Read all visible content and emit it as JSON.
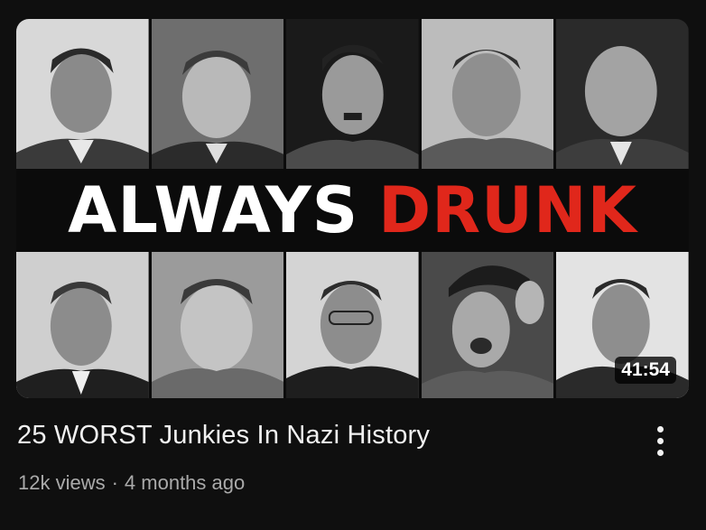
{
  "video": {
    "thumbnail_text_1": "ALWAYS",
    "thumbnail_text_2": "DRUNK",
    "duration": "41:54",
    "title": "25 WORST Junkies In Nazi History",
    "views": "12k views",
    "separator": "·",
    "age": "4 months ago",
    "more_icon": "vertical-ellipsis-icon"
  },
  "colors": {
    "background": "#0f0f0f",
    "banner_white": "#ffffff",
    "banner_red": "#e0271b",
    "title": "#f1f1f1",
    "meta": "#aaaaaa"
  }
}
